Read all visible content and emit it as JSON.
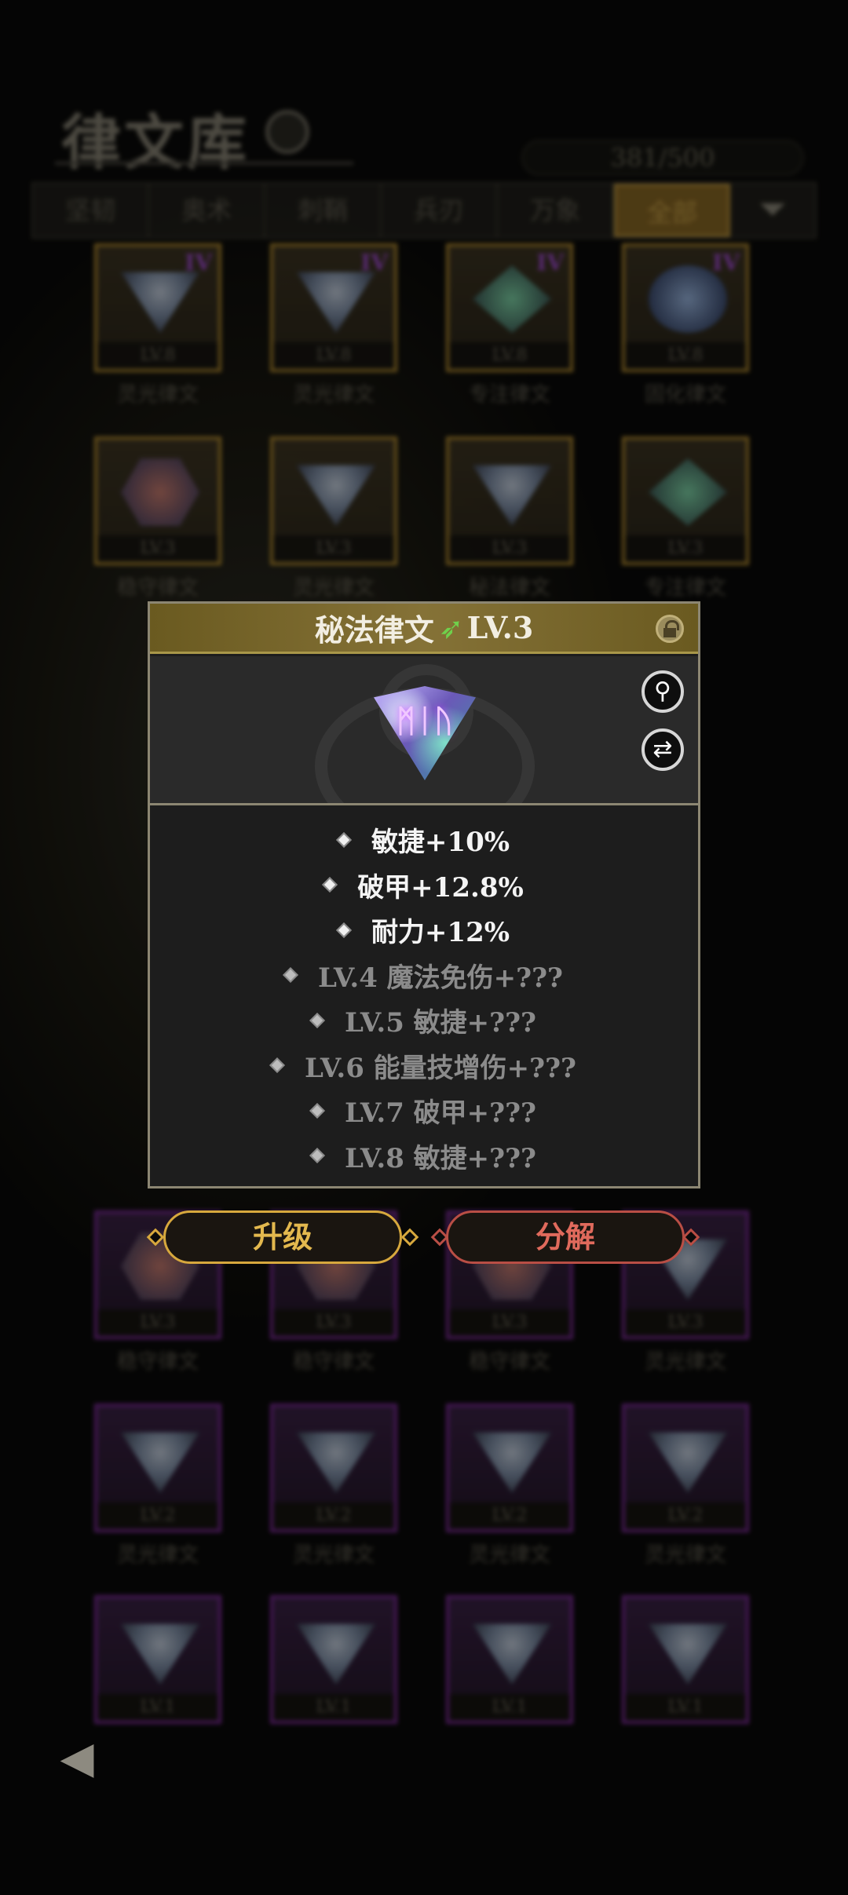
{
  "library": {
    "title": "律文库",
    "capacity": "381/500",
    "filters": [
      "坚韧",
      "奥术",
      "刺鞘",
      "兵刃",
      "万象",
      "全部"
    ],
    "active_filter": "全部"
  },
  "inventory_rows": [
    [
      {
        "name": "灵光律文",
        "level": "LV.8",
        "tag": "IV",
        "frame": "gold",
        "gem": "tri"
      },
      {
        "name": "灵光律文",
        "level": "LV.8",
        "tag": "IV",
        "frame": "gold",
        "gem": "tri"
      },
      {
        "name": "专注律文",
        "level": "LV.8",
        "tag": "IV",
        "frame": "gold",
        "gem": "diamond"
      },
      {
        "name": "固化律文",
        "level": "LV.8",
        "tag": "IV",
        "frame": "gold",
        "gem": "round"
      }
    ],
    [
      {
        "name": "稳守律文",
        "level": "LV.3",
        "tag": "",
        "frame": "gold",
        "gem": "hex"
      },
      {
        "name": "灵光律文",
        "level": "LV.3",
        "tag": "",
        "frame": "gold",
        "gem": "tri"
      },
      {
        "name": "秘法律文",
        "level": "LV.3",
        "tag": "",
        "frame": "gold",
        "gem": "tri"
      },
      {
        "name": "专注律文",
        "level": "LV.3",
        "tag": "",
        "frame": "gold",
        "gem": "diamond"
      }
    ],
    [
      {
        "name": "稳守律文",
        "level": "LV.3",
        "tag": "",
        "frame": "purple",
        "gem": "hex"
      },
      {
        "name": "稳守律文",
        "level": "LV.3",
        "tag": "",
        "frame": "purple",
        "gem": "hex"
      },
      {
        "name": "稳守律文",
        "level": "LV.3",
        "tag": "",
        "frame": "purple",
        "gem": "hex"
      },
      {
        "name": "灵光律文",
        "level": "LV.3",
        "tag": "",
        "frame": "purple",
        "gem": "tri"
      }
    ],
    [
      {
        "name": "灵光律文",
        "level": "LV.2",
        "tag": "",
        "frame": "purple",
        "gem": "tri"
      },
      {
        "name": "灵光律文",
        "level": "LV.2",
        "tag": "",
        "frame": "purple",
        "gem": "tri"
      },
      {
        "name": "灵光律文",
        "level": "LV.2",
        "tag": "",
        "frame": "purple",
        "gem": "tri"
      },
      {
        "name": "灵光律文",
        "level": "LV.2",
        "tag": "",
        "frame": "purple",
        "gem": "tri"
      }
    ],
    [
      {
        "name": "",
        "level": "LV.1",
        "tag": "",
        "frame": "purple",
        "gem": "tri"
      },
      {
        "name": "",
        "level": "LV.1",
        "tag": "",
        "frame": "purple",
        "gem": "tri"
      },
      {
        "name": "",
        "level": "LV.1",
        "tag": "",
        "frame": "purple",
        "gem": "tri"
      },
      {
        "name": "",
        "level": "LV.1",
        "tag": "",
        "frame": "purple",
        "gem": "tri"
      }
    ]
  ],
  "popup": {
    "title": "秘法律文",
    "level": "LV.3",
    "grade_icon": "green-feather-icon",
    "rune_symbol": "ᛗᛁᚢ",
    "stats": [
      {
        "text": "敏捷+10%",
        "active": true
      },
      {
        "text": "破甲+12.8%",
        "active": true
      },
      {
        "text": "耐力+12%",
        "active": true
      },
      {
        "text": "LV.4  魔法免伤+???",
        "active": false
      },
      {
        "text": "LV.5  敏捷+???",
        "active": false
      },
      {
        "text": "LV.6  能量技增伤+???",
        "active": false
      },
      {
        "text": "LV.7  破甲+???",
        "active": false
      },
      {
        "text": "LV.8  敏捷+???",
        "active": false
      }
    ]
  },
  "actions": {
    "upgrade": "升级",
    "decompose": "分解"
  },
  "icons": {
    "search": "search-icon",
    "filter": "filter-icon",
    "lock": "lock-icon",
    "magnify": "magnify-icon",
    "swap": "swap-icon",
    "back": "back-icon"
  },
  "colors": {
    "gold": "#d7a83d",
    "red": "#b94e45",
    "purple": "#7d2a9a"
  }
}
